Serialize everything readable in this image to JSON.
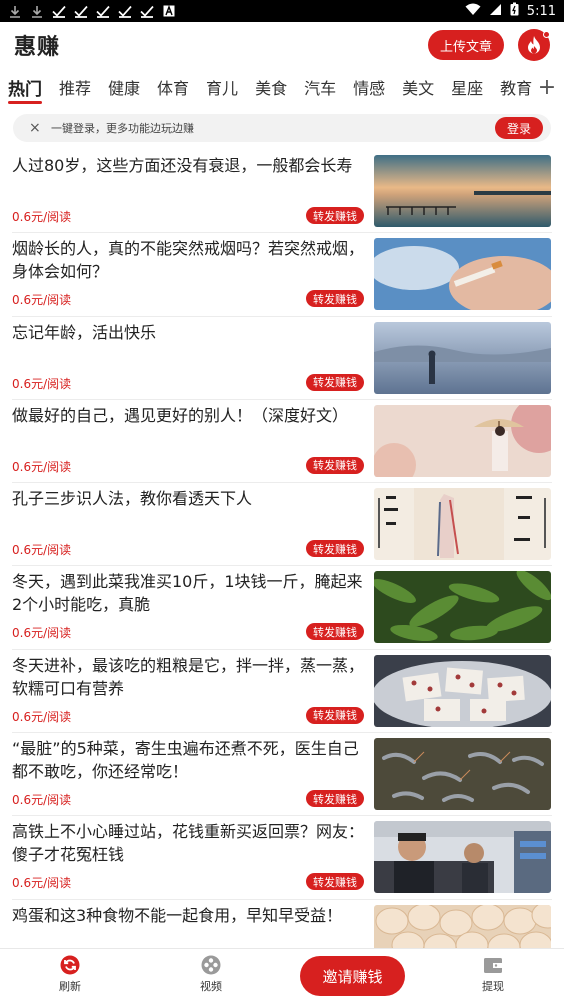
{
  "status_bar": {
    "time": "5:11",
    "notification_icons": [
      "download-icon",
      "download-icon",
      "check-icon",
      "check-icon",
      "check-icon",
      "check-icon",
      "check-icon",
      "a-icon"
    ]
  },
  "header": {
    "title": "惠赚",
    "upload_label": "上传文章"
  },
  "tabs": [
    "热门",
    "推荐",
    "健康",
    "体育",
    "育儿",
    "美食",
    "汽车",
    "情感",
    "美文",
    "星座",
    "教育"
  ],
  "tab_add": "+",
  "login_banner": {
    "close": "×",
    "text": "一键登录，更多功能边玩边赚",
    "button": "登录"
  },
  "articles": [
    {
      "title": "人过80岁，这些方面还没有衰退，一般都会长寿",
      "price": "0.6元/阅读",
      "share": "转发赚钱",
      "thumb": "sunset-pier"
    },
    {
      "title": "烟龄长的人，真的不能突然戒烟吗？若突然戒烟，身体会如何？",
      "price": "0.6元/阅读",
      "share": "转发赚钱",
      "thumb": "cigarette"
    },
    {
      "title": "忘记年龄，活出快乐",
      "price": "0.6元/阅读",
      "share": "转发赚钱",
      "thumb": "misty-lake"
    },
    {
      "title": "做最好的自己，遇见更好的别人！（深度好文）",
      "price": "0.6元/阅读",
      "share": "转发赚钱",
      "thumb": "umbrella-woman"
    },
    {
      "title": "孔子三步识人法，教你看透天下人",
      "price": "0.6元/阅读",
      "share": "转发赚钱",
      "thumb": "calligraphy"
    },
    {
      "title": "冬天，遇到此菜我准买10斤，1块钱一斤，腌起来2个小时能吃，真脆",
      "price": "0.6元/阅读",
      "share": "转发赚钱",
      "thumb": "okra"
    },
    {
      "title": "冬天进补，最该吃的粗粮是它，拌一拌，蒸一蒸，软糯可口有营养",
      "price": "0.6元/阅读",
      "share": "转发赚钱",
      "thumb": "rice-cake"
    },
    {
      "title": "“最脏”的5种菜，寄生虫遍布还煮不死，医生自己都不敢吃，你还经常吃！",
      "price": "0.6元/阅读",
      "share": "转发赚钱",
      "thumb": "shrimp"
    },
    {
      "title": "高铁上不小心睡过站，花钱重新买返回票？网友：傻子才花冤枉钱",
      "price": "0.6元/阅读",
      "share": "转发赚钱",
      "thumb": "train-passengers"
    },
    {
      "title": "鸡蛋和这3种食物不能一起食用，早知早受益！",
      "price": "",
      "share": "",
      "thumb": "eggs"
    }
  ],
  "bottom_nav": {
    "refresh": "刷新",
    "video": "视频",
    "invite": "邀请赚钱",
    "withdraw": "提现"
  },
  "colors": {
    "accent": "#d7201f"
  }
}
